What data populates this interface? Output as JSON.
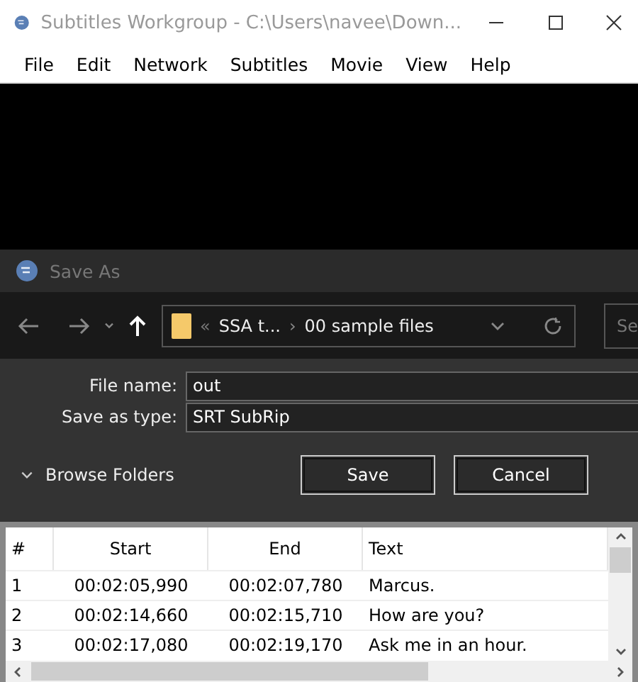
{
  "window": {
    "title": "Subtitles Workgroup - C:\\Users\\navee\\Down..."
  },
  "menu": [
    "File",
    "Edit",
    "Network",
    "Subtitles",
    "Movie",
    "View",
    "Help"
  ],
  "dialog": {
    "title": "Save As",
    "breadcrumb": {
      "overflow": "«",
      "parent": "SSA t...",
      "separator": "›",
      "current": "00 sample files"
    },
    "search": {
      "placeholder": "Se"
    },
    "file_name": {
      "label": "File name:",
      "value": "out"
    },
    "save_as_type": {
      "label": "Save as type:",
      "value": "SRT SubRip"
    },
    "browse_folders": "Browse Folders",
    "buttons": [
      "Save",
      "Cancel"
    ]
  },
  "table": {
    "columns": [
      "#",
      "Start",
      "End",
      "Text"
    ],
    "rows": [
      {
        "cells": [
          "1",
          "00:02:05,990",
          "00:02:07,780",
          "Marcus."
        ]
      },
      {
        "cells": [
          "2",
          "00:02:14,660",
          "00:02:15,710",
          "How are you?"
        ]
      },
      {
        "cells": [
          "3",
          "00:02:17,080",
          "00:02:19,170",
          "Ask me in an hour."
        ]
      }
    ]
  }
}
